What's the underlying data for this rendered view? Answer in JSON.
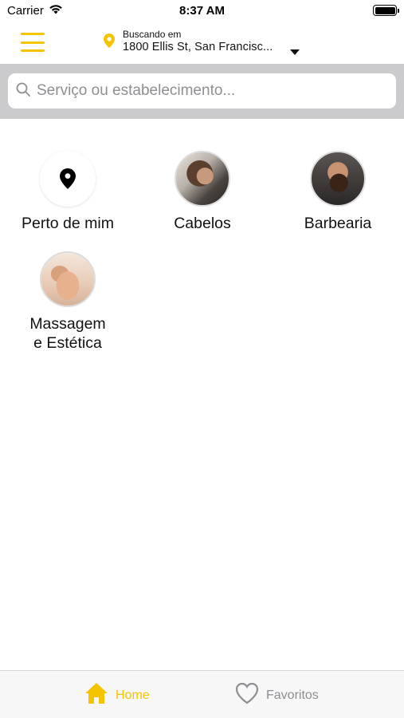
{
  "status_bar": {
    "carrier": "Carrier",
    "time": "8:37 AM",
    "wifi_icon": "wifi-icon",
    "battery_icon": "battery-icon"
  },
  "header": {
    "menu_icon": "hamburger-menu-icon",
    "location_icon": "location-pin-icon",
    "location_prefix": "Buscando em",
    "location_address": "1800 Ellis St, San Francisc...",
    "dropdown_icon": "caret-down-icon"
  },
  "search": {
    "icon": "search-icon",
    "placeholder": "Serviço ou estabelecimento...",
    "value": ""
  },
  "categories": [
    {
      "label": "Perto de mim",
      "icon": "map-pin-icon"
    },
    {
      "label": "Cabelos",
      "icon": "haircut-photo"
    },
    {
      "label": "Barbearia",
      "icon": "beard-photo"
    },
    {
      "label_line1": "Massagem",
      "label_line2": "e Estética",
      "icon": "massage-photo"
    }
  ],
  "tab_bar": {
    "home_label": "Home",
    "home_icon": "home-icon",
    "favorites_label": "Favoritos",
    "favorites_icon": "heart-icon"
  },
  "colors": {
    "accent": "#f5c400",
    "search_bg": "#cbcbcd",
    "inactive": "#8e8e93"
  }
}
